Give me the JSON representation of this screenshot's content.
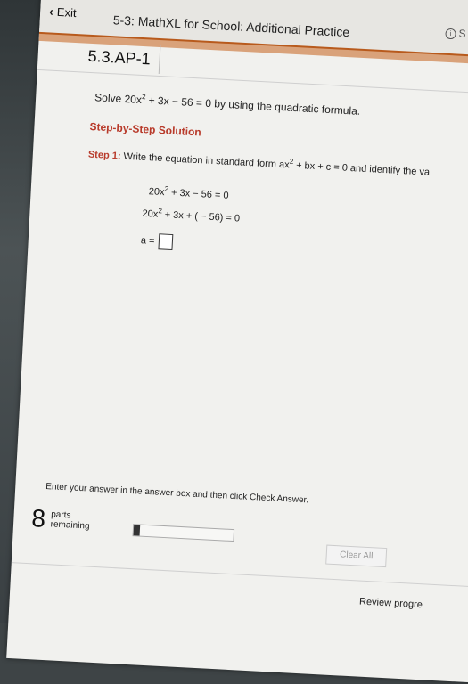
{
  "header": {
    "exit_label": "Exit",
    "app_title": "5-3: MathXL for School: Additional Practice",
    "topright_label": "S"
  },
  "problem": {
    "id": "5.3.AP-1",
    "statement_prefix": "Solve 20x",
    "statement_exp": "2",
    "statement_suffix": " + 3x − 56 = 0 by using the quadratic formula."
  },
  "steps": {
    "heading": "Step-by-Step Solution",
    "step1_label": "Step 1:",
    "step1_text_a": "Write the equation in standard form ax",
    "step1_exp": "2",
    "step1_text_b": " + bx + c = 0 and identify the va",
    "eq1_a": "20x",
    "eq1_exp": "2",
    "eq1_b": " + 3x − 56  =  0",
    "eq2_a": "20x",
    "eq2_exp": "2",
    "eq2_b": " + 3x + ( − 56)  =  0",
    "answer_prefix": "a ="
  },
  "footer": {
    "instruction": "Enter your answer in the answer box and then click Check Answer.",
    "parts_count": "8",
    "parts_line1": "parts",
    "parts_line2": "remaining",
    "progress_value": 0.0,
    "clear_all_label": "Clear All",
    "review_label": "Review progre"
  }
}
